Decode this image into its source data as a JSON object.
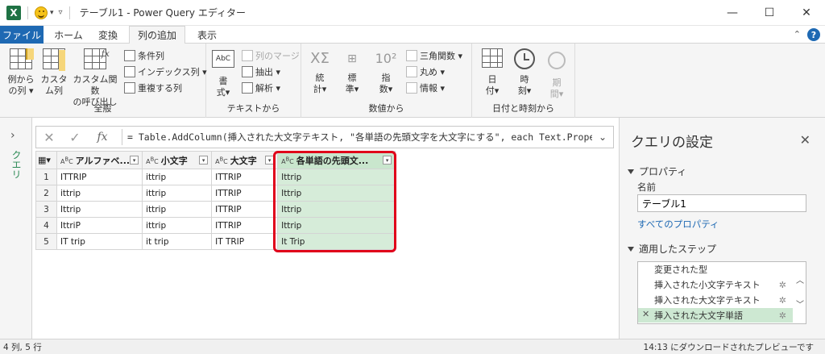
{
  "window": {
    "title": "テーブル1 - Power Query エディター",
    "app_icon_letter": "X"
  },
  "tabs": [
    {
      "label": "ファイル"
    },
    {
      "label": "ホーム"
    },
    {
      "label": "変換"
    },
    {
      "label": "列の追加"
    },
    {
      "label": "表示"
    }
  ],
  "ribbon": {
    "general": {
      "label": "全般",
      "example_col": "例から\n の列",
      "example_col_l1": "例から",
      "example_col_l2": "の列",
      "custom_col_l1": "カスタ",
      "custom_col_l2": "ム列",
      "invoke_l1": "カスタム関数",
      "invoke_l2": "の呼び出し",
      "conditional": "条件列",
      "index": "インデックス列",
      "duplicate": "重複する列"
    },
    "text": {
      "label": "テキストから",
      "format_l1": "書",
      "format_l2": "式",
      "merge": "列のマージ",
      "extract": "抽出",
      "parse": "解析"
    },
    "number": {
      "label": "数値から",
      "stats_l1": "統",
      "stats_l2": "計",
      "std_l1": "標",
      "std_l2": "準",
      "sci_l1": "指",
      "sci_l2": "数",
      "trig": "三角関数",
      "round": "丸め",
      "info": "情報"
    },
    "datetime": {
      "label": "日付と時刻から",
      "date_l1": "日",
      "date_l2": "付",
      "time_l1": "時",
      "time_l2": "刻",
      "duration_l1": "期",
      "duration_l2": "間"
    }
  },
  "left_rail": {
    "label": "クエリ"
  },
  "formula_bar": {
    "formula": "= Table.AddColumn(挿入された大文字テキスト, \"各単語の先頭文字を大文字にする\", each Text.Proper"
  },
  "table": {
    "columns": [
      "アルファベ...",
      "小文字",
      "大文字",
      "各単語の先頭文..."
    ],
    "rows": [
      [
        "1",
        "ITTRIP",
        "ittrip",
        "ITTRIP",
        "Ittrip"
      ],
      [
        "2",
        "ittrip",
        "ittrip",
        "ITTRIP",
        "Ittrip"
      ],
      [
        "3",
        "Ittrip",
        "ittrip",
        "ITTRIP",
        "Ittrip"
      ],
      [
        "4",
        "IttriP",
        "ittrip",
        "ITTRIP",
        "Ittrip"
      ],
      [
        "5",
        "IT trip",
        "it trip",
        "IT TRIP",
        "It Trip"
      ]
    ]
  },
  "query_settings": {
    "title": "クエリの設定",
    "properties_header": "プロパティ",
    "name_label": "名前",
    "name_value": "テーブル1",
    "all_properties": "すべてのプロパティ",
    "applied_steps_header": "適用したステップ",
    "steps": [
      {
        "label": "変更された型",
        "selected": false
      },
      {
        "label": "挿入された小文字テキスト",
        "selected": false
      },
      {
        "label": "挿入された大文字テキスト",
        "selected": false
      },
      {
        "label": "挿入された大文字単語",
        "selected": true
      }
    ]
  },
  "status": {
    "left": "4 列, 5 行",
    "right": "14:13 にダウンロードされたプレビューです"
  },
  "colors": {
    "accent": "#1e69b3",
    "excel_green": "#1f7244",
    "highlight_column": "#d6ecd9",
    "callout": "#e0001a"
  }
}
